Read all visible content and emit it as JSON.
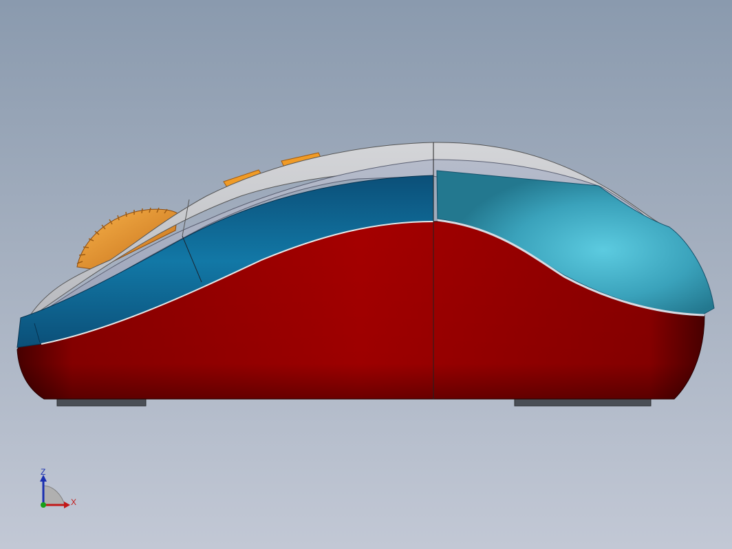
{
  "viewport": {
    "background_top": "#8a9aae",
    "background_bottom": "#c2c8d5"
  },
  "model": {
    "colors": {
      "base_shell": "#a30000",
      "side_band_rear": "#0f6a95",
      "side_band_front": "#3ba4bd",
      "top_cover": "#c9cbcf",
      "inner_trim": "#a9b0c4",
      "scroll_wheel": "#f09b26",
      "side_buttons": "#f09b26",
      "feet": "#4a4e55"
    }
  },
  "triad": {
    "z_label": "Z",
    "x_label": "X",
    "z_color": "#1a2fb0",
    "x_color": "#c21818",
    "y_color": "#18a018"
  }
}
